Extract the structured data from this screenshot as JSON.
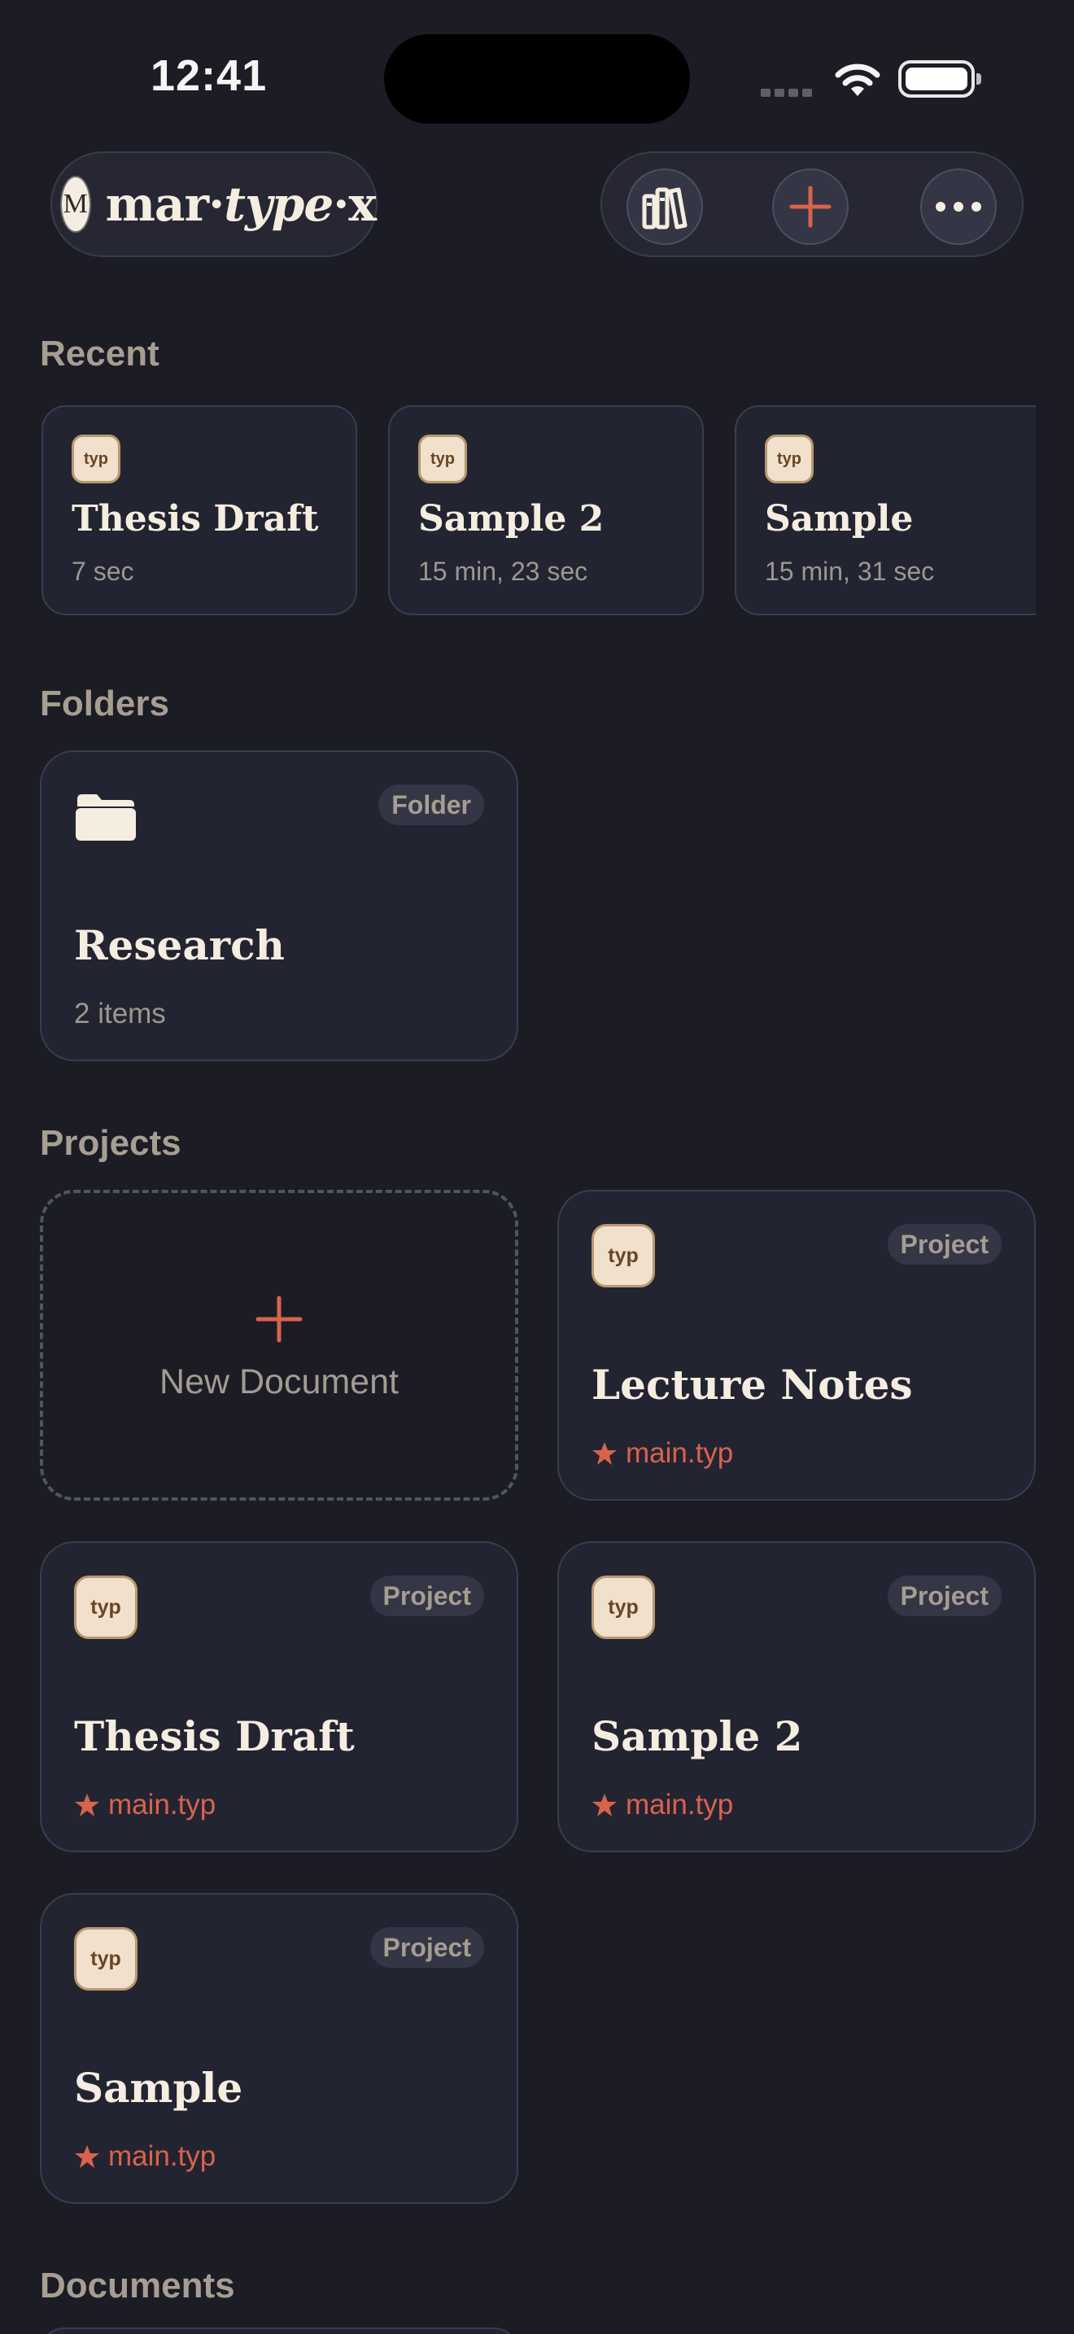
{
  "status_bar": {
    "time": "12:41"
  },
  "header": {
    "logo_mark": "M",
    "logo_part1": "mar·",
    "logo_part2": "type",
    "logo_part3": "·x"
  },
  "sections": {
    "recent": "Recent",
    "folders": "Folders",
    "projects": "Projects",
    "documents": "Documents"
  },
  "typ_icon_label": "typ",
  "recent": [
    {
      "title": "Thesis Draft",
      "time": "7 sec"
    },
    {
      "title": "Sample 2",
      "time": "15 min, 23 sec"
    },
    {
      "title": "Sample",
      "time": "15 min, 31 sec"
    }
  ],
  "folders": [
    {
      "badge": "Folder",
      "title": "Research",
      "count": "2 items"
    }
  ],
  "new_document_label": "New Document",
  "projects": [
    {
      "badge": "Project",
      "title": "Lecture Notes",
      "main_file": "main.typ"
    },
    {
      "badge": "Project",
      "title": "Thesis Draft",
      "main_file": "main.typ"
    },
    {
      "badge": "Project",
      "title": "Sample 2",
      "main_file": "main.typ"
    },
    {
      "badge": "Project",
      "title": "Sample",
      "main_file": "main.typ"
    }
  ],
  "colors": {
    "background": "#1c1c25",
    "card": "#232431",
    "accent": "#d8634d",
    "cream": "#f4ede0"
  }
}
